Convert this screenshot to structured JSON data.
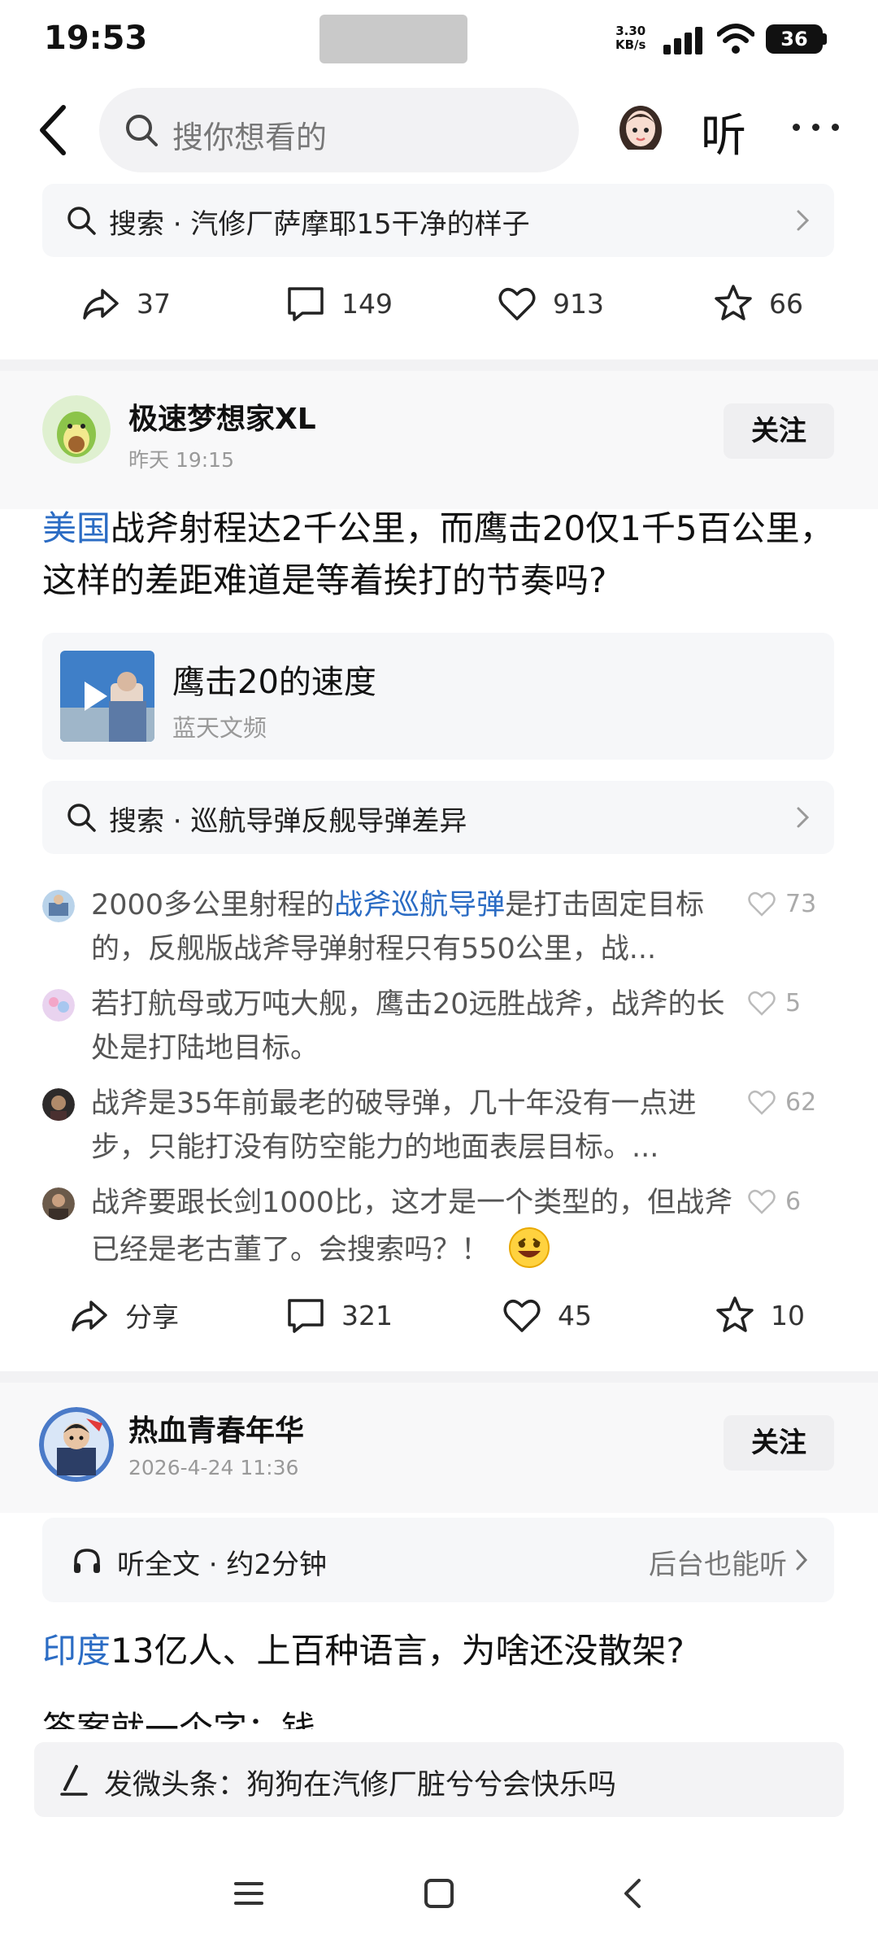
{
  "status_bar": {
    "time": "19:53",
    "net_speed_value": "3.30",
    "net_speed_unit": "KB/s",
    "battery": "36"
  },
  "top_nav": {
    "search_placeholder": "搜你想看的",
    "listen_label": "听"
  },
  "post1": {
    "search_suggestion": "搜索 · 汽修厂萨摩耶15干净的样子",
    "actions": {
      "share": "37",
      "comment": "149",
      "like": "913",
      "favorite": "66"
    }
  },
  "post2": {
    "author": "极速梦想家XL",
    "time": "昨天  19:15",
    "follow_label": "关注",
    "title_highlight": "美国",
    "title_rest": "战斧射程达2千公里，而鹰击20仅1千5百公里，这样的差距难道是等着挨打的节奏吗?",
    "video": {
      "title": "鹰击20的速度",
      "source": "蓝天文频"
    },
    "search_suggestion": "搜索 · 巡航导弹反舰导弹差异",
    "comments": [
      {
        "pre": "2000多公里射程的",
        "link": "战斧巡航导弹",
        "post": "是打击固定目标的，反舰版战斧导弹射程只有550公里，战...",
        "likes": "73"
      },
      {
        "pre": "若打航母或万吨大舰，鹰击20远胜战斧，战斧的长处是打陆地目标。",
        "link": "",
        "post": "",
        "likes": "5"
      },
      {
        "pre": "战斧是35年前最老的破导弹，几十年没有一点进步，只能打没有防空能力的地面表层目标。...",
        "link": "",
        "post": "",
        "likes": "62"
      },
      {
        "pre": "战斧要跟长剑1000比，这才是一个类型的，但战斧已经是老古董了。会搜索吗？！ ",
        "link": "",
        "post": "",
        "likes": "6"
      }
    ],
    "actions": {
      "share": "分享",
      "comment": "321",
      "like": "45",
      "favorite": "10"
    }
  },
  "post3": {
    "author": "热血青春年华",
    "time": "2026-4-24 11:36",
    "follow_label": "关注",
    "listen_left": "听全文 · 约2分钟",
    "listen_right": "后台也能听",
    "title_highlight": "印度",
    "title_rest": "13亿人、上百种语言，为啥还没散架?",
    "body_partial": "答案就一个字：钱"
  },
  "compose": {
    "text": "发微头条：狗狗在汽修厂脏兮兮会快乐吗"
  },
  "icons": [
    "back-icon",
    "search-icon",
    "more-icon",
    "share-icon",
    "comment-icon",
    "like-icon",
    "star-icon",
    "chevron-right-icon",
    "headphone-icon",
    "pen-icon",
    "menu-icon",
    "home-icon"
  ],
  "colors": {
    "link_blue": "#2b6cc4",
    "muted": "#999999",
    "panel": "#f6f7f9"
  }
}
